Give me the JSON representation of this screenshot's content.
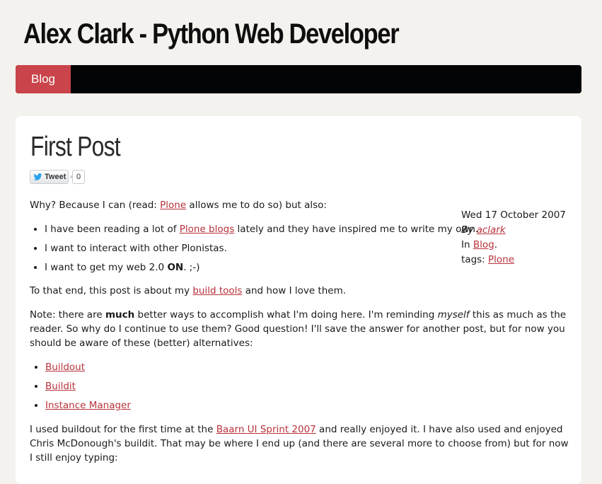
{
  "site": {
    "title": "Alex Clark - Python Web Developer"
  },
  "nav": {
    "items": [
      {
        "label": "Blog"
      }
    ]
  },
  "post": {
    "title": "First Post",
    "tweet": {
      "label": "Tweet",
      "count": "0"
    },
    "meta": {
      "date": "Wed 17 October 2007",
      "by_prefix": "By",
      "author": "aclark",
      "in_prefix": "In",
      "category": "Blog",
      "in_suffix": ".",
      "tags_prefix": "tags:",
      "tag": "Plone"
    },
    "intro": {
      "before": "Why? Because I can (read: ",
      "link": "Plone",
      "after": " allows me to do so) but also:"
    },
    "reasons": [
      {
        "before": "I have been reading a lot of ",
        "link": "Plone blogs",
        "after": " lately and they have inspired me to write my own."
      },
      {
        "text": "I want to interact with other Plonistas."
      },
      {
        "before": "I want to get my web 2.0 ",
        "bold": "ON",
        "after": ". ;-)"
      }
    ],
    "to_that_end": {
      "before": "To that end, this post is about my ",
      "link": "build tools",
      "after": " and how I love them."
    },
    "note": {
      "part1": "Note: there are ",
      "bold": "much",
      "part2": " better ways to accomplish what I'm doing here. I'm reminding ",
      "italic": "myself",
      "part3": " this as much as the reader. So why do I continue to use them? Good question! I'll save the answer for another post, but for now you should be aware of these (better) alternatives:"
    },
    "alternatives": [
      "Buildout",
      "Buildit",
      "Instance Manager"
    ],
    "buildout": {
      "before": "I used buildout for the first time at the ",
      "link": "Baarn UI Sprint 2007",
      "after": " and really enjoyed it. I have also used and enjoyed Chris McDonough's buildit. That may be where I end up (and there are several more to choose from) but for now I still enjoy typing:"
    }
  },
  "colors": {
    "background": "#f4f2ee",
    "navbar": "#030406",
    "accent": "#c9444b",
    "link": "#b8323b",
    "card": "#ffffff"
  },
  "icons": {
    "tweet": "twitter-bird-icon"
  }
}
